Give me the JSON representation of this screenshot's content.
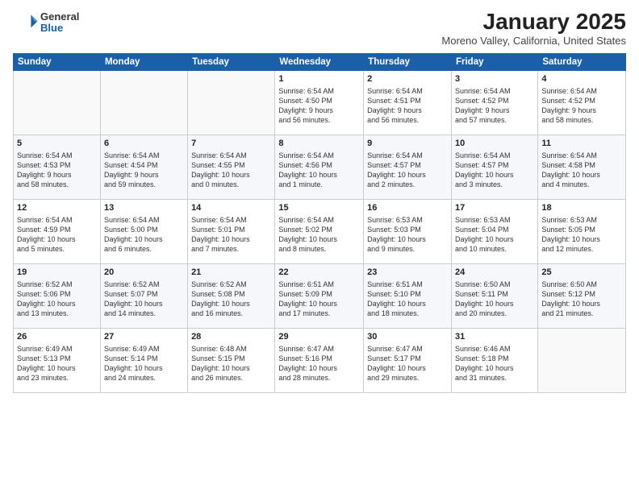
{
  "header": {
    "logo_general": "General",
    "logo_blue": "Blue",
    "title": "January 2025",
    "location": "Moreno Valley, California, United States"
  },
  "days_of_week": [
    "Sunday",
    "Monday",
    "Tuesday",
    "Wednesday",
    "Thursday",
    "Friday",
    "Saturday"
  ],
  "weeks": [
    [
      {
        "num": "",
        "info": ""
      },
      {
        "num": "",
        "info": ""
      },
      {
        "num": "",
        "info": ""
      },
      {
        "num": "1",
        "info": "Sunrise: 6:54 AM\nSunset: 4:50 PM\nDaylight: 9 hours\nand 56 minutes."
      },
      {
        "num": "2",
        "info": "Sunrise: 6:54 AM\nSunset: 4:51 PM\nDaylight: 9 hours\nand 56 minutes."
      },
      {
        "num": "3",
        "info": "Sunrise: 6:54 AM\nSunset: 4:52 PM\nDaylight: 9 hours\nand 57 minutes."
      },
      {
        "num": "4",
        "info": "Sunrise: 6:54 AM\nSunset: 4:52 PM\nDaylight: 9 hours\nand 58 minutes."
      }
    ],
    [
      {
        "num": "5",
        "info": "Sunrise: 6:54 AM\nSunset: 4:53 PM\nDaylight: 9 hours\nand 58 minutes."
      },
      {
        "num": "6",
        "info": "Sunrise: 6:54 AM\nSunset: 4:54 PM\nDaylight: 9 hours\nand 59 minutes."
      },
      {
        "num": "7",
        "info": "Sunrise: 6:54 AM\nSunset: 4:55 PM\nDaylight: 10 hours\nand 0 minutes."
      },
      {
        "num": "8",
        "info": "Sunrise: 6:54 AM\nSunset: 4:56 PM\nDaylight: 10 hours\nand 1 minute."
      },
      {
        "num": "9",
        "info": "Sunrise: 6:54 AM\nSunset: 4:57 PM\nDaylight: 10 hours\nand 2 minutes."
      },
      {
        "num": "10",
        "info": "Sunrise: 6:54 AM\nSunset: 4:57 PM\nDaylight: 10 hours\nand 3 minutes."
      },
      {
        "num": "11",
        "info": "Sunrise: 6:54 AM\nSunset: 4:58 PM\nDaylight: 10 hours\nand 4 minutes."
      }
    ],
    [
      {
        "num": "12",
        "info": "Sunrise: 6:54 AM\nSunset: 4:59 PM\nDaylight: 10 hours\nand 5 minutes."
      },
      {
        "num": "13",
        "info": "Sunrise: 6:54 AM\nSunset: 5:00 PM\nDaylight: 10 hours\nand 6 minutes."
      },
      {
        "num": "14",
        "info": "Sunrise: 6:54 AM\nSunset: 5:01 PM\nDaylight: 10 hours\nand 7 minutes."
      },
      {
        "num": "15",
        "info": "Sunrise: 6:54 AM\nSunset: 5:02 PM\nDaylight: 10 hours\nand 8 minutes."
      },
      {
        "num": "16",
        "info": "Sunrise: 6:53 AM\nSunset: 5:03 PM\nDaylight: 10 hours\nand 9 minutes."
      },
      {
        "num": "17",
        "info": "Sunrise: 6:53 AM\nSunset: 5:04 PM\nDaylight: 10 hours\nand 10 minutes."
      },
      {
        "num": "18",
        "info": "Sunrise: 6:53 AM\nSunset: 5:05 PM\nDaylight: 10 hours\nand 12 minutes."
      }
    ],
    [
      {
        "num": "19",
        "info": "Sunrise: 6:52 AM\nSunset: 5:06 PM\nDaylight: 10 hours\nand 13 minutes."
      },
      {
        "num": "20",
        "info": "Sunrise: 6:52 AM\nSunset: 5:07 PM\nDaylight: 10 hours\nand 14 minutes."
      },
      {
        "num": "21",
        "info": "Sunrise: 6:52 AM\nSunset: 5:08 PM\nDaylight: 10 hours\nand 16 minutes."
      },
      {
        "num": "22",
        "info": "Sunrise: 6:51 AM\nSunset: 5:09 PM\nDaylight: 10 hours\nand 17 minutes."
      },
      {
        "num": "23",
        "info": "Sunrise: 6:51 AM\nSunset: 5:10 PM\nDaylight: 10 hours\nand 18 minutes."
      },
      {
        "num": "24",
        "info": "Sunrise: 6:50 AM\nSunset: 5:11 PM\nDaylight: 10 hours\nand 20 minutes."
      },
      {
        "num": "25",
        "info": "Sunrise: 6:50 AM\nSunset: 5:12 PM\nDaylight: 10 hours\nand 21 minutes."
      }
    ],
    [
      {
        "num": "26",
        "info": "Sunrise: 6:49 AM\nSunset: 5:13 PM\nDaylight: 10 hours\nand 23 minutes."
      },
      {
        "num": "27",
        "info": "Sunrise: 6:49 AM\nSunset: 5:14 PM\nDaylight: 10 hours\nand 24 minutes."
      },
      {
        "num": "28",
        "info": "Sunrise: 6:48 AM\nSunset: 5:15 PM\nDaylight: 10 hours\nand 26 minutes."
      },
      {
        "num": "29",
        "info": "Sunrise: 6:47 AM\nSunset: 5:16 PM\nDaylight: 10 hours\nand 28 minutes."
      },
      {
        "num": "30",
        "info": "Sunrise: 6:47 AM\nSunset: 5:17 PM\nDaylight: 10 hours\nand 29 minutes."
      },
      {
        "num": "31",
        "info": "Sunrise: 6:46 AM\nSunset: 5:18 PM\nDaylight: 10 hours\nand 31 minutes."
      },
      {
        "num": "",
        "info": ""
      }
    ]
  ]
}
